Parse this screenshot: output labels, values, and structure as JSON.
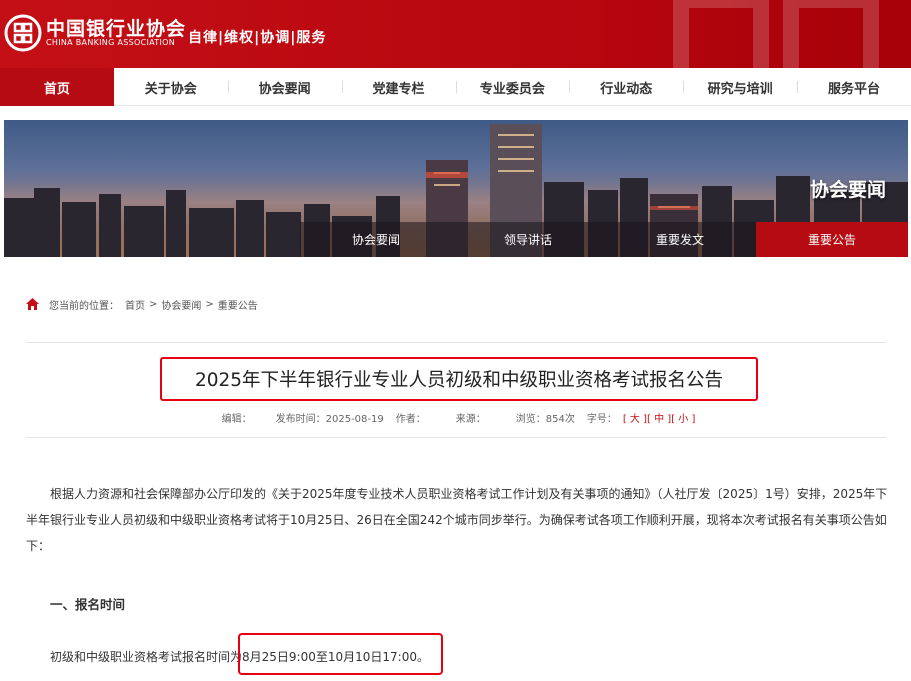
{
  "header": {
    "org_name_cn": "中国银行业协会",
    "org_name_en": "CHINA BANKING ASSOCIATION",
    "slogan": "自律|维权|协调|服务"
  },
  "nav": {
    "items": [
      {
        "label": "首页",
        "active": true
      },
      {
        "label": "关于协会",
        "active": false
      },
      {
        "label": "协会要闻",
        "active": false
      },
      {
        "label": "党建专栏",
        "active": false
      },
      {
        "label": "专业委员会",
        "active": false
      },
      {
        "label": "行业动态",
        "active": false
      },
      {
        "label": "研究与培训",
        "active": false
      },
      {
        "label": "服务平台",
        "active": false
      }
    ]
  },
  "banner": {
    "title": "协会要闻",
    "subnav": [
      {
        "label": "协会要闻",
        "active": false
      },
      {
        "label": "领导讲话",
        "active": false
      },
      {
        "label": "重要发文",
        "active": false
      },
      {
        "label": "重要公告",
        "active": true
      }
    ]
  },
  "breadcrumb": {
    "prefix": "您当前的位置：",
    "items": [
      "首页",
      "协会要闻",
      "重要公告"
    ],
    "separator": ">"
  },
  "article": {
    "title": "2025年下半年银行业专业人员初级和中级职业资格考试报名公告",
    "meta": {
      "editor": "编辑：",
      "publish_time": "发布时间：2025-08-19",
      "author": "作者：",
      "source": "来源：",
      "views": "浏览：854次",
      "font_size_label": "字号：",
      "size_large": "[ 大 ]",
      "size_medium": "[ 中 ]",
      "size_small": "[ 小 ]"
    },
    "intro": "根据人力资源和社会保障部办公厅印发的《关于2025年度专业技术人员职业资格考试工作计划及有关事项的通知》（人社厅发〔2025〕1号）安排，2025年下半年银行业专业人员初级和中级职业资格考试将于10月25日、26日在全国242个城市同步举行。为确保考试各项工作顺利开展，现将本次考试报名有关事项公告如下：",
    "section1_title": "一、报名时间",
    "registration_text": "初级和中级职业资格考试报名时间为8月25日9:00至10月10日17:00。"
  },
  "colors": {
    "brand_red": "#b60b12",
    "highlight_red": "#e60012"
  },
  "icons": {
    "home": "home-icon",
    "logo": "cba-logo-icon"
  }
}
